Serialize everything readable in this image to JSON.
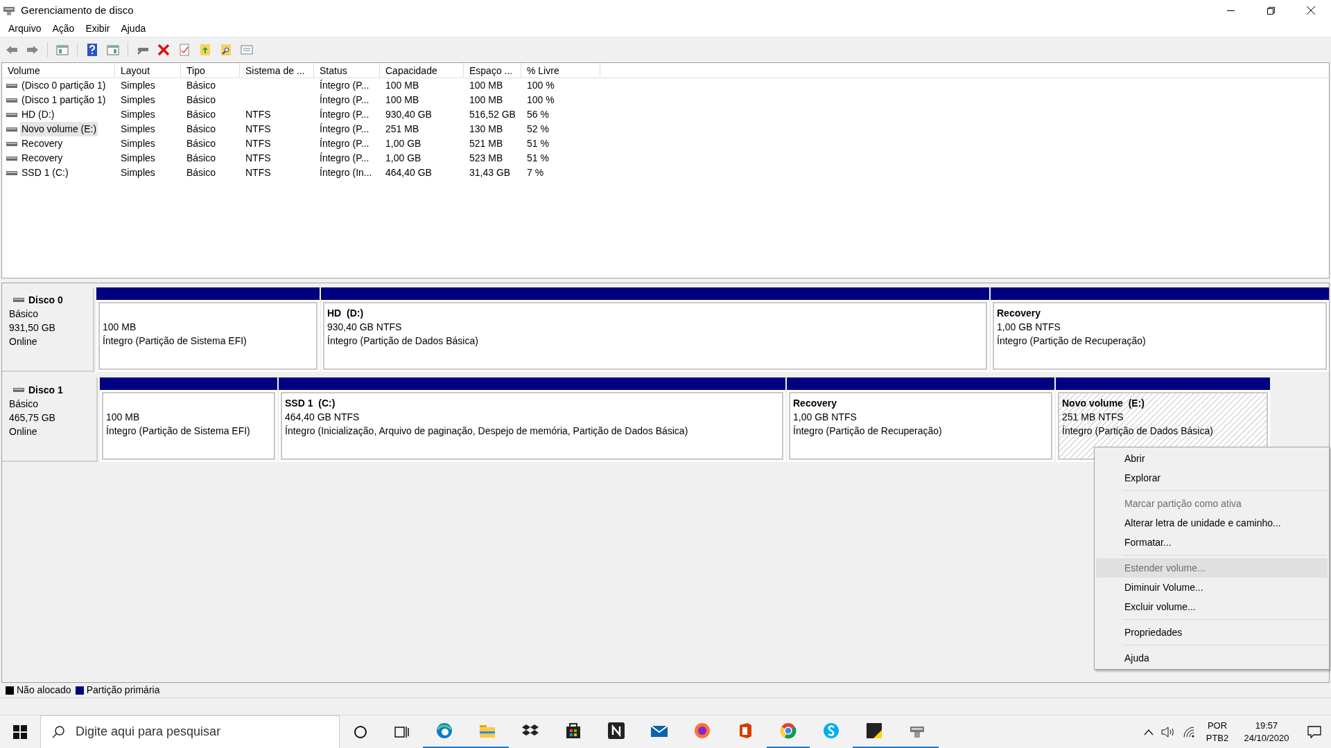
{
  "window": {
    "title": "Gerenciamento de disco"
  },
  "menu": [
    "Arquivo",
    "Ação",
    "Exibir",
    "Ajuda"
  ],
  "table": {
    "columns": [
      "Volume",
      "Layout",
      "Tipo",
      "Sistema de ...",
      "Status",
      "Capacidade",
      "Espaço ...",
      "% Livre"
    ],
    "rows": [
      {
        "cells": [
          "(Disco 0 partição 1)",
          "Simples",
          "Básico",
          "",
          "Íntegro (P...",
          "100 MB",
          "100 MB",
          "100 %"
        ],
        "selected": false
      },
      {
        "cells": [
          "(Disco 1 partição 1)",
          "Simples",
          "Básico",
          "",
          "Íntegro (P...",
          "100 MB",
          "100 MB",
          "100 %"
        ],
        "selected": false
      },
      {
        "cells": [
          "HD (D:)",
          "Simples",
          "Básico",
          "NTFS",
          "Íntegro (P...",
          "930,40 GB",
          "516,52 GB",
          "56 %"
        ],
        "selected": false
      },
      {
        "cells": [
          "Novo volume (E:)",
          "Simples",
          "Básico",
          "NTFS",
          "Íntegro (P...",
          "251 MB",
          "130 MB",
          "52 %"
        ],
        "selected": true
      },
      {
        "cells": [
          "Recovery",
          "Simples",
          "Básico",
          "NTFS",
          "Íntegro (P...",
          "1,00 GB",
          "521 MB",
          "51 %"
        ],
        "selected": false
      },
      {
        "cells": [
          "Recovery",
          "Simples",
          "Básico",
          "NTFS",
          "Íntegro (P...",
          "1,00 GB",
          "523 MB",
          "51 %"
        ],
        "selected": false
      },
      {
        "cells": [
          "SSD 1 (C:)",
          "Simples",
          "Básico",
          "NTFS",
          "Íntegro (In...",
          "464,40 GB",
          "31,43 GB",
          "7 %"
        ],
        "selected": false
      }
    ]
  },
  "disks": [
    {
      "name": "Disco 0",
      "type": "Básico",
      "size": "931,50 GB",
      "state": "Online",
      "partitions": [
        {
          "size": "100 MB",
          "status": "Íntegro (Partição de Sistema EFI)",
          "selected": false
        },
        {
          "name": "HD  (D:)",
          "size": "930,40 GB NTFS",
          "status": "Íntegro (Partição de Dados Básica)",
          "selected": false
        },
        {
          "name": "Recovery",
          "size": "1,00 GB NTFS",
          "status": "Íntegro (Partição de Recuperação)",
          "selected": false
        }
      ]
    },
    {
      "name": "Disco 1",
      "type": "Básico",
      "size": "465,75 GB",
      "state": "Online",
      "partitions": [
        {
          "size": "100 MB",
          "status": "Íntegro (Partição de Sistema EFI)",
          "selected": false
        },
        {
          "name": "SSD 1  (C:)",
          "size": "464,40 GB NTFS",
          "status": "Íntegro (Inicialização, Arquivo de paginação, Despejo de memória, Partição de Dados Básica)",
          "selected": false
        },
        {
          "name": "Recovery",
          "size": "1,00 GB NTFS",
          "status": "Íntegro (Partição de Recuperação)",
          "selected": false
        },
        {
          "name": "Novo volume  (E:)",
          "size": "251 MB NTFS",
          "status": "Íntegro (Partição de Dados Básica)",
          "selected": true
        }
      ]
    }
  ],
  "legend": [
    {
      "label": "Não alocado",
      "color": "#000000"
    },
    {
      "label": "Partição primária",
      "color": "#000080"
    }
  ],
  "context_menu": [
    {
      "label": "Abrir",
      "disabled": false,
      "highlighted": false,
      "separator_before": false
    },
    {
      "label": "Explorar",
      "disabled": false,
      "highlighted": false,
      "separator_before": false
    },
    {
      "label": "Marcar partição como ativa",
      "disabled": true,
      "highlighted": false,
      "separator_before": true
    },
    {
      "label": "Alterar letra de unidade e caminho...",
      "disabled": false,
      "highlighted": false,
      "separator_before": false
    },
    {
      "label": "Formatar...",
      "disabled": false,
      "highlighted": false,
      "separator_before": false
    },
    {
      "label": "Estender volume...",
      "disabled": true,
      "highlighted": true,
      "separator_before": true
    },
    {
      "label": "Diminuir Volume...",
      "disabled": false,
      "highlighted": false,
      "separator_before": false
    },
    {
      "label": "Excluir volume...",
      "disabled": false,
      "highlighted": false,
      "separator_before": false
    },
    {
      "label": "Propriedades",
      "disabled": false,
      "highlighted": false,
      "separator_before": true
    },
    {
      "label": "Ajuda",
      "disabled": false,
      "highlighted": false,
      "separator_before": true
    }
  ],
  "taskbar": {
    "search": {
      "placeholder": "Digite aqui para pesquisar"
    },
    "apps": [
      {
        "open": true
      },
      {
        "open": true
      },
      {
        "open": false
      },
      {
        "open": false
      },
      {
        "open": false
      },
      {
        "open": false
      },
      {
        "open": false
      },
      {
        "open": false
      },
      {
        "open": true
      },
      {
        "open": false
      },
      {
        "open": true
      },
      {
        "open": true
      }
    ],
    "language": "POR",
    "layout": "PTB2",
    "time": "19:57",
    "date": "24/10/2020"
  }
}
